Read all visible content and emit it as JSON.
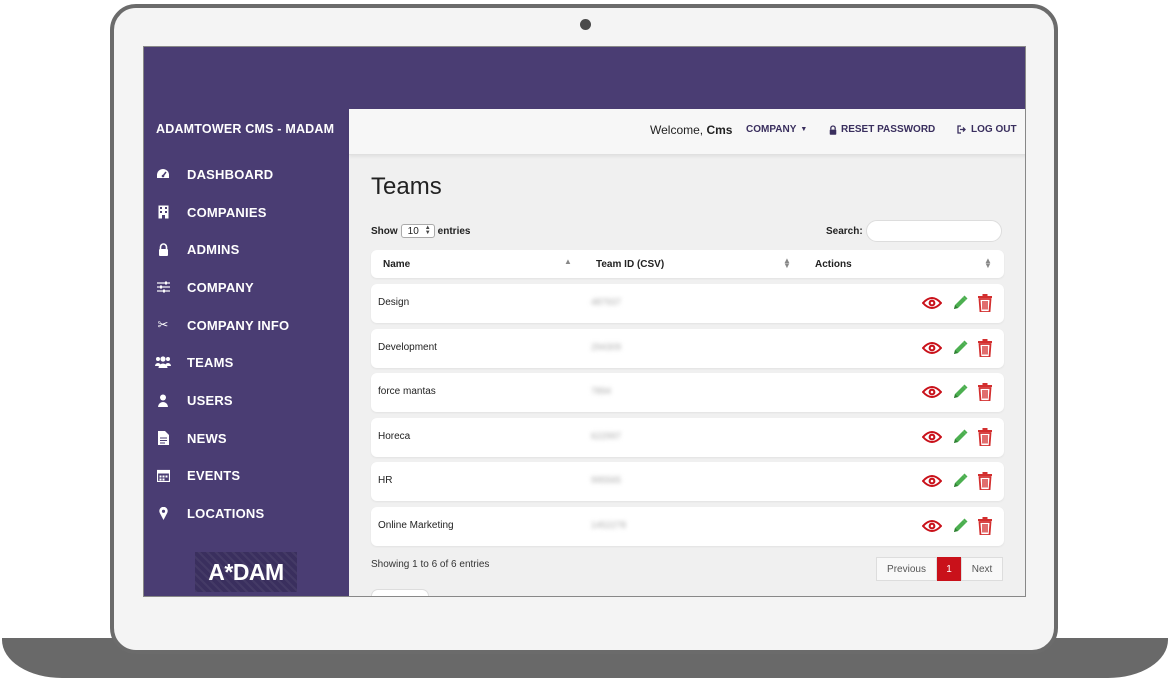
{
  "app": {
    "brand": "ADAMTOWER CMS - MADAM",
    "logo_text": "A*DAM"
  },
  "sidebar": {
    "items": [
      {
        "label": "DASHBOARD",
        "icon": "dashboard-icon"
      },
      {
        "label": "COMPANIES",
        "icon": "building-icon"
      },
      {
        "label": "ADMINS",
        "icon": "lock-icon"
      },
      {
        "label": "COMPANY",
        "icon": "sliders-icon"
      },
      {
        "label": "COMPANY INFO",
        "icon": "scissors-icon"
      },
      {
        "label": "TEAMS",
        "icon": "users-group-icon"
      },
      {
        "label": "USERS",
        "icon": "user-icon"
      },
      {
        "label": "NEWS",
        "icon": "document-icon"
      },
      {
        "label": "EVENTS",
        "icon": "calendar-icon"
      },
      {
        "label": "LOCATIONS",
        "icon": "map-marker-icon"
      }
    ]
  },
  "header": {
    "welcome_prefix": "Welcome, ",
    "welcome_user": "Cms",
    "company_label": "COMPANY",
    "reset_password_label": "RESET PASSWORD",
    "logout_label": "LOG OUT"
  },
  "main": {
    "title": "Teams",
    "show_label": "Show",
    "entries_value": "10",
    "entries_label": "entries",
    "search_label": "Search:",
    "search_value": "",
    "columns": [
      "Name",
      "Team ID (CSV)",
      "Actions"
    ],
    "rows": [
      {
        "name": "Design",
        "team_id": "487937"
      },
      {
        "name": "Development",
        "team_id": "294309"
      },
      {
        "name": "force mantas",
        "team_id": "7894"
      },
      {
        "name": "Horeca",
        "team_id": "622997"
      },
      {
        "name": "HR",
        "team_id": "995565"
      },
      {
        "name": "Online Marketing",
        "team_id": "1452278"
      }
    ],
    "showing_text": "Showing 1 to 6 of 6 entries",
    "pagination": {
      "previous": "Previous",
      "current": "1",
      "next": "Next"
    }
  },
  "colors": {
    "sidebar_bg": "#4a3d73",
    "view_icon": "#c9111a",
    "edit_icon": "#4caf50",
    "delete_icon": "#d32f2f",
    "active_page": "#c9111a"
  }
}
